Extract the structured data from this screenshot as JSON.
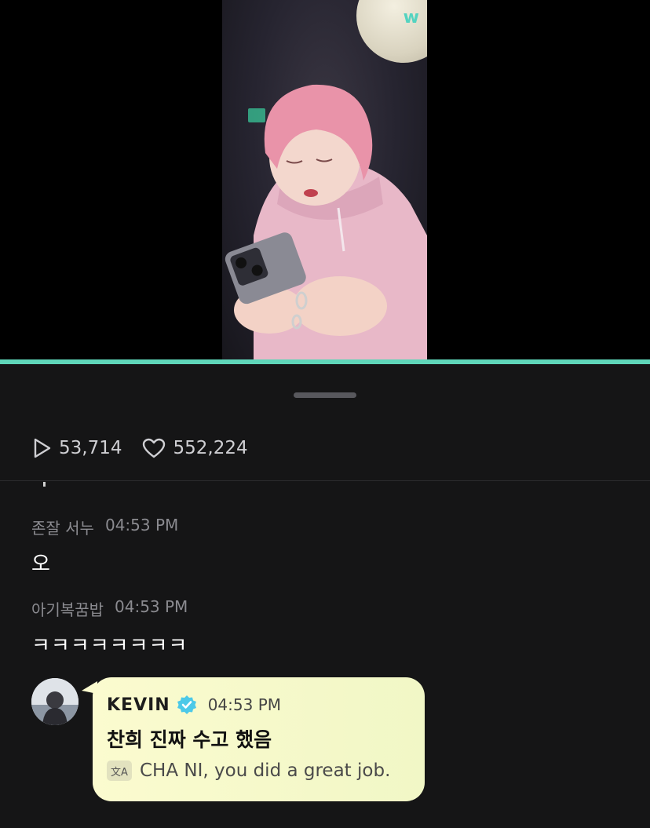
{
  "video": {
    "brand_logo": "w",
    "progress_fraction": 1.0,
    "progress_color": "#5fd6b9"
  },
  "stats": {
    "plays": "53,714",
    "likes": "552,224",
    "play_icon": "play-icon",
    "like_icon": "heart-icon"
  },
  "comments": [
    {
      "user": "존잘 서누",
      "time": "04:53 PM",
      "text": "오"
    },
    {
      "user": "아기복꿈밥",
      "time": "04:53 PM",
      "text": "ㅋㅋㅋㅋㅋㅋㅋㅋ"
    }
  ],
  "artist_comment": {
    "name": "KEVIN",
    "verified_icon": "verified-badge-icon",
    "time": "04:53 PM",
    "text": "찬희 진짜 수고 했음",
    "translation_icon": "translate-icon",
    "translation": "CHA NI, you did a great job.",
    "bubble_color": "#fbfbcf"
  }
}
